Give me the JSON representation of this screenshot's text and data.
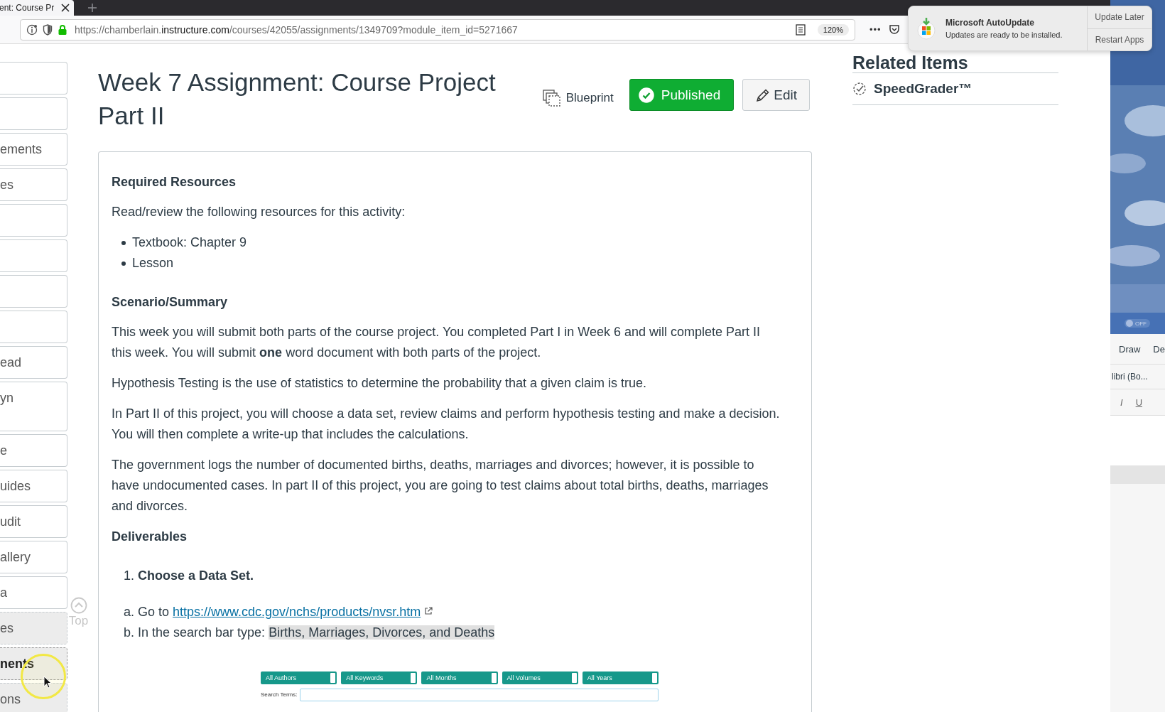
{
  "browser": {
    "tab": {
      "title": "ent: Course Pr"
    },
    "url": {
      "scheme_host": "https://chamberlain.",
      "domain": "instructure.com",
      "path": "/courses/42055/assignments/1349709?module_item_id=5271667"
    },
    "zoom": "120%",
    "more": "•••"
  },
  "notification": {
    "title": "Microsoft AutoUpdate",
    "body": "Updates are ready to be installed.",
    "buttons": [
      "Update Later",
      "Restart Apps"
    ]
  },
  "sidebar": {
    "items": [
      {
        "selected": false,
        "hidden": false
      },
      {
        "selected": false,
        "hidden": false
      },
      {
        "label": "ements",
        "selected": false,
        "hidden": false
      },
      {
        "label": "es",
        "selected": false,
        "hidden": false
      },
      {
        "selected": false,
        "hidden": false
      },
      {
        "selected": false,
        "hidden": false
      },
      {
        "selected": false,
        "hidden": false
      },
      {
        "selected": false,
        "hidden": false
      },
      {
        "label": "ead",
        "selected": false,
        "hidden": false
      },
      {
        "label": "yn",
        "selected": false,
        "hidden": false,
        "tall": true
      },
      {
        "label": "e",
        "selected": false,
        "hidden": false
      },
      {
        "label": "uides",
        "selected": false,
        "hidden": false
      },
      {
        "label": "udit",
        "selected": false,
        "hidden": false
      },
      {
        "label": "allery",
        "selected": false,
        "hidden": false
      },
      {
        "label": "a",
        "selected": false,
        "hidden": false
      },
      {
        "label": "es",
        "selected": false,
        "hidden": true
      },
      {
        "label": "nents",
        "selected": true,
        "hidden": true
      },
      {
        "label": "ons",
        "selected": false,
        "hidden": true
      }
    ]
  },
  "top_link": "Top",
  "assignment": {
    "title": "Week 7 Assignment: Course Project Part II",
    "blueprint": "Blueprint",
    "publish": {
      "label": "Published",
      "on": true
    },
    "edit": "Edit"
  },
  "related": {
    "heading": "Related Items",
    "items": [
      "SpeedGrader™"
    ]
  },
  "body": [
    {
      "kind": "heading",
      "text": "Required Resources"
    },
    {
      "kind": "paragraph",
      "text": "Read/review the following resources for this activity:"
    },
    {
      "kind": "bullets",
      "items": [
        "Textbook: Chapter 9",
        "Lesson"
      ]
    },
    {
      "kind": "heading",
      "text": "Scenario/Summary"
    },
    {
      "kind": "paragraph",
      "text": "This week you will submit both parts of the course project. You completed Part I in Week 6 and will complete Part II this week. You will submit **one** word document with both parts of the project."
    },
    {
      "kind": "paragraph",
      "text": "Hypothesis Testing is the use of statistics to determine the probability that a given claim is true."
    },
    {
      "kind": "paragraph",
      "text": "In Part II of this project, you will choose a data set, review claims and perform hypothesis testing and make a decision. You will then complete a write-up that includes the calculations."
    },
    {
      "kind": "paragraph",
      "text": "The government logs the number of documented births, deaths, marriages and divorces; however, it is possible to have undocumented cases. In part II of this project, you are going to test claims about total births, deaths, marriages and divorces."
    },
    {
      "kind": "heading",
      "text": "Deliverables"
    },
    {
      "kind": "numbered",
      "items": [
        "1. **Choose a Data Set.**"
      ]
    },
    {
      "kind": "steps",
      "items": [
        {
          "text": "a. Go to ",
          "link": "https://www.cdc.gov/nchs/products/nvsr.htm"
        },
        {
          "text": "b. In the search bar type: ",
          "highlight": "Births, Marriages, Divorces, and Deaths"
        }
      ]
    },
    {
      "kind": "screenshot",
      "dropdowns": [
        "All Authors",
        "All Keywords",
        "All Months",
        "All Volumes",
        "All Years"
      ],
      "search_label": "Search Terms:"
    }
  ],
  "desktop": {
    "word": {
      "toggle": {
        "label": "OFF",
        "on": false
      },
      "tabs": [
        "Draw",
        "De"
      ],
      "font": "libri (Bo...",
      "format": [
        "I",
        "U"
      ]
    }
  }
}
